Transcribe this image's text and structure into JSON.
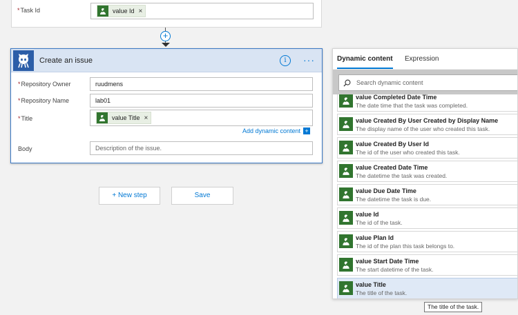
{
  "prev_step": {
    "label": "Task Id",
    "token": "value Id"
  },
  "issue": {
    "title": "Create an issue",
    "info_glyph": "i",
    "more_glyph": "···",
    "fields": {
      "owner_label": "Repository Owner",
      "owner_value": "ruudmens",
      "name_label": "Repository Name",
      "name_value": "lab01",
      "title_label": "Title",
      "title_token": "value Title",
      "body_label": "Body",
      "body_placeholder": "Description of the issue."
    },
    "add_dynamic": "Add dynamic content"
  },
  "buttons": {
    "new_step": "+ New step",
    "save": "Save"
  },
  "dynamic": {
    "tab_dynamic": "Dynamic content",
    "tab_expression": "Expression",
    "search_placeholder": "Search dynamic content",
    "items": [
      {
        "title": "value Completed Date Time",
        "desc": "The date time that the task was completed."
      },
      {
        "title": "value Created By User Created by Display Name",
        "desc": "The display name of the user who created this task."
      },
      {
        "title": "value Created By User Id",
        "desc": "The id of the user who created this task."
      },
      {
        "title": "value Created Date Time",
        "desc": "The datetime the task was created."
      },
      {
        "title": "value Due Date Time",
        "desc": "The datetime the task is due."
      },
      {
        "title": "value Id",
        "desc": "The id of the task."
      },
      {
        "title": "value Plan Id",
        "desc": "The id of the plan this task belongs to."
      },
      {
        "title": "value Start Date Time",
        "desc": "The start datetime of the task."
      },
      {
        "title": "value Title",
        "desc": "The title of the task."
      }
    ]
  },
  "tooltip": "The title of the task.",
  "colors": {
    "accent": "#0078d4",
    "planner_green": "#31752f",
    "github_blue": "#2c5ea8"
  },
  "icons": {
    "planner": "planner-icon",
    "github": "github-octocat-icon",
    "search": "search-icon",
    "add": "plus-circle-icon",
    "info": "info-icon",
    "more": "more-ellipsis-icon"
  }
}
